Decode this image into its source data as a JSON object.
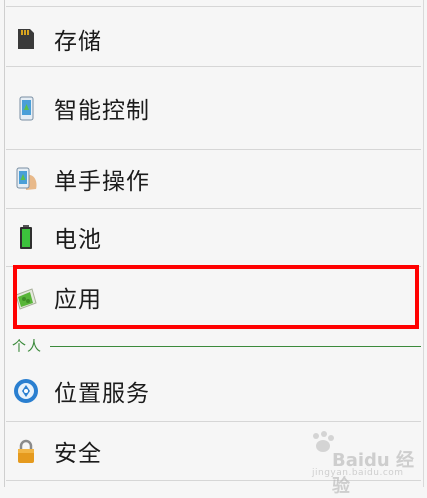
{
  "settings": {
    "items": [
      {
        "label": "存储",
        "icon": "sd-card-icon"
      },
      {
        "label": "智能控制",
        "icon": "smart-control-icon"
      },
      {
        "label": "单手操作",
        "icon": "one-hand-icon"
      },
      {
        "label": "电池",
        "icon": "battery-icon"
      },
      {
        "label": "应用",
        "icon": "apps-icon"
      }
    ],
    "section_personal": "个人",
    "personal_items": [
      {
        "label": "位置服务",
        "icon": "location-icon"
      },
      {
        "label": "安全",
        "icon": "lock-icon"
      }
    ]
  },
  "watermark": {
    "brand": "Baidu 经验",
    "url": "jingyan.baidu.com"
  },
  "colors": {
    "highlight": "#ff0000",
    "section_accent": "#3b8a3b"
  }
}
